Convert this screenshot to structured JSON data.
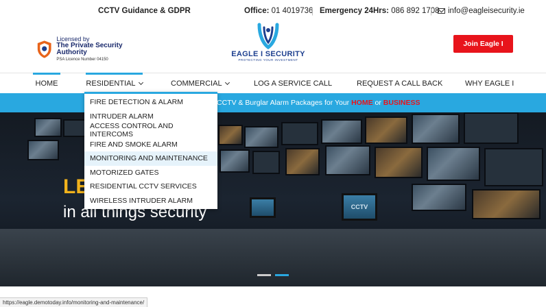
{
  "topbar": {
    "gdpr": "CCTV Guidance & GDPR",
    "office_label": "Office:",
    "office_number": "01 4019736",
    "emergency_label": "Emergency 24Hrs:",
    "emergency_number": "086 892 1708",
    "email": "info@eagleisecurity.ie",
    "email_icon": "envelope-icon"
  },
  "psa": {
    "line1": "Licensed by",
    "line2": "The Private Security Authority",
    "line3": "PSA Licence Number 04150",
    "icon": "psa-shield-icon"
  },
  "logo": {
    "name": "EAGLE I SECURITY",
    "tagline": "PROTECTING YOUR INVESTMENT"
  },
  "join_label": "Join Eagle I",
  "nav": {
    "items": [
      {
        "label": "HOME"
      },
      {
        "label": "RESIDENTIAL",
        "has_submenu": true
      },
      {
        "label": "COMMERCIAL",
        "has_submenu": true
      },
      {
        "label": "LOG A SERVICE CALL"
      },
      {
        "label": "REQUEST A CALL BACK"
      },
      {
        "label": "WHY EAGLE I"
      }
    ]
  },
  "strip": {
    "text": "CCTV & Burglar Alarm Packages for Your",
    "home": "HOME",
    "or": "or",
    "business": "BUSINESS"
  },
  "hero": {
    "headline": "LE",
    "subline": "in all things security",
    "monitor_label": "CCTV",
    "slide_count": 2,
    "active_slide": 2
  },
  "dropdown": {
    "items": [
      "FIRE DETECTION & ALARM",
      "INTRUDER ALARM",
      "ACCESS CONTROL AND INTERCOMS",
      "FIRE AND SMOKE ALARM",
      "MONITORING AND MAINTENANCE",
      "MOTORIZED GATES",
      "RESIDENTIAL CCTV SERVICES",
      "WIRELESS INTRUDER ALARM"
    ],
    "hovered_index": 4
  },
  "status_url": "https://eagle.demotoday.info/monitoring-and-maintenance/",
  "colors": {
    "accent": "#29a8e0",
    "brand_red": "#e8141b",
    "brand_blue": "#1d3f8f",
    "headline_gold": "#f1b21c"
  }
}
